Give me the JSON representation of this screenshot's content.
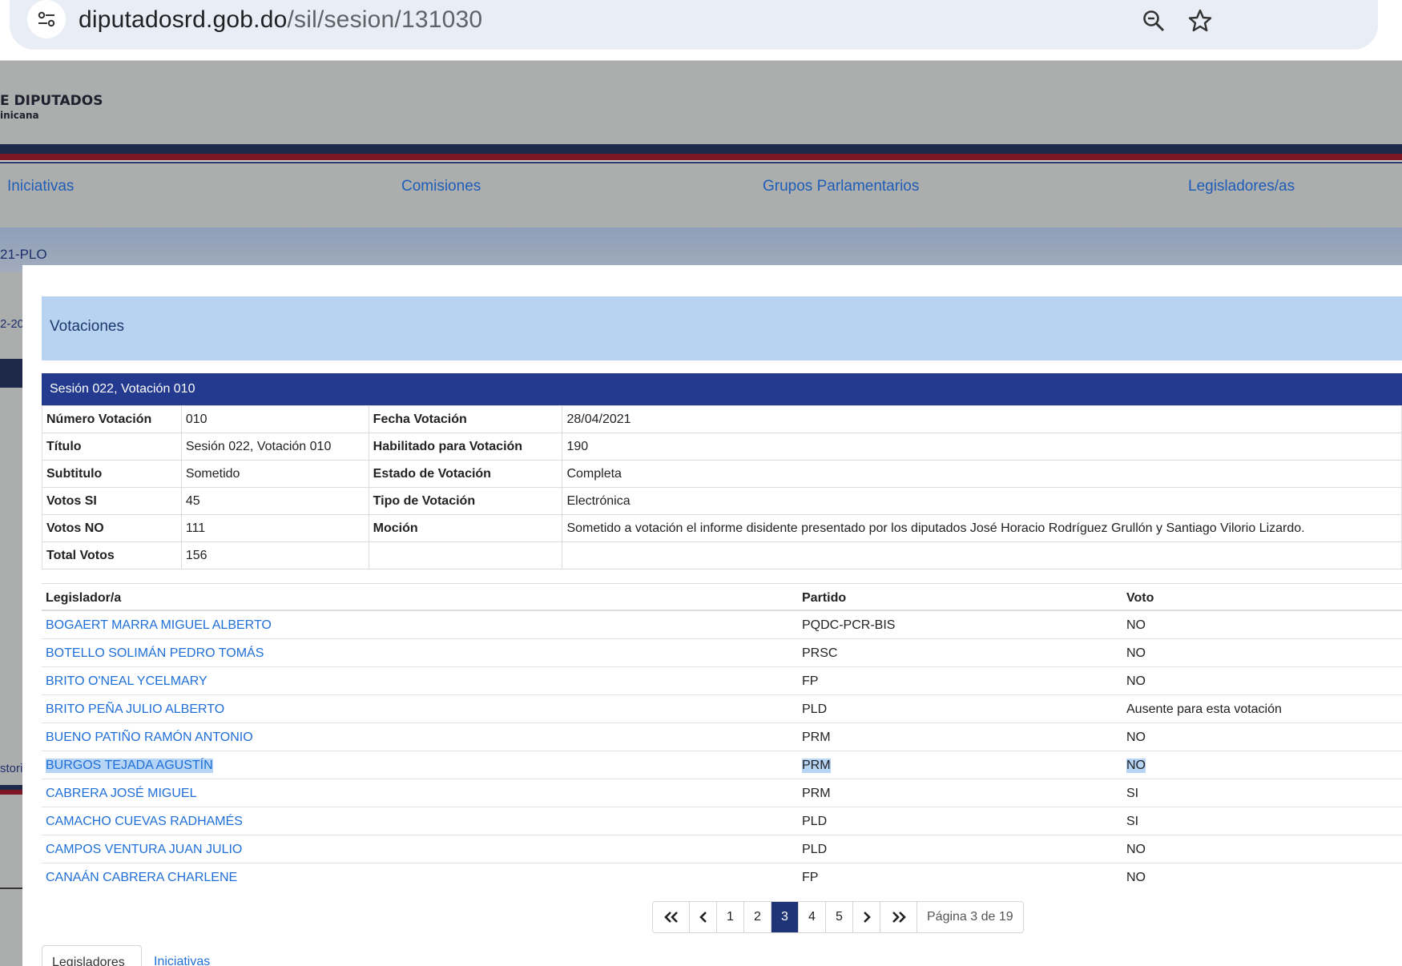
{
  "browser": {
    "url_domain": "diputadosrd.gob.do",
    "url_path": "/sil/sesion/131030",
    "site_info_icon": "tune-icon",
    "zoom_icon": "zoom-icon",
    "bookmark_icon": "star-icon"
  },
  "site": {
    "logo_line1": "E DIPUTADOS",
    "logo_line2": "inicana",
    "nav": [
      "Iniciativas",
      "Comisiones",
      "Grupos Parlamentarios",
      "Legisladores/as"
    ],
    "bg_fragments": [
      "21-PLO",
      "2-20",
      "stori"
    ]
  },
  "modal": {
    "section_title": "Votaciones",
    "session_title": "Sesión 022, Votación 010",
    "info": {
      "numero_votacion_label": "Número Votación",
      "numero_votacion": "010",
      "fecha_votacion_label": "Fecha Votación",
      "fecha_votacion": "28/04/2021",
      "titulo_label": "Título",
      "titulo": "Sesión 022, Votación 010",
      "habilitado_label": "Habilitado para Votación",
      "habilitado": "190",
      "subtitulo_label": "Subtitulo",
      "subtitulo": "Sometido",
      "estado_label": "Estado de Votación",
      "estado": "Completa",
      "votos_si_label": "Votos SI",
      "votos_si": "45",
      "tipo_label": "Tipo de Votación",
      "tipo": "Electrónica",
      "votos_no_label": "Votos NO",
      "votos_no": "111",
      "mocion_label": "Moción",
      "mocion": "Sometido a votación el informe disidente presentado por los diputados José Horacio Rodríguez Grullón y Santiago Vilorio Lizardo.",
      "total_label": "Total Votos",
      "total": "156"
    },
    "table": {
      "headers": {
        "legislator": "Legislador/a",
        "party": "Partido",
        "vote": "Voto"
      },
      "rows": [
        {
          "name": "BOGAERT MARRA MIGUEL ALBERTO",
          "party": "PQDC-PCR-BIS",
          "vote": "NO"
        },
        {
          "name": "BOTELLO SOLIMÁN PEDRO TOMÁS",
          "party": "PRSC",
          "vote": "NO"
        },
        {
          "name": "BRITO O'NEAL YCELMARY",
          "party": "FP",
          "vote": "NO"
        },
        {
          "name": "BRITO PEÑA JULIO ALBERTO",
          "party": "PLD",
          "vote": "Ausente para esta votación"
        },
        {
          "name": "BUENO PATIÑO RAMÓN ANTONIO",
          "party": "PRM",
          "vote": "NO"
        },
        {
          "name": "BURGOS TEJADA AGUSTÍN",
          "party": "PRM",
          "vote": "NO"
        },
        {
          "name": "CABRERA JOSÉ MIGUEL",
          "party": "PRM",
          "vote": "SI"
        },
        {
          "name": "CAMACHO CUEVAS RADHAMÉS",
          "party": "PLD",
          "vote": "SI"
        },
        {
          "name": "CAMPOS VENTURA JUAN JULIO",
          "party": "PLD",
          "vote": "NO"
        },
        {
          "name": "CANAÁN CABRERA CHARLENE",
          "party": "FP",
          "vote": "NO"
        }
      ]
    },
    "pagination": {
      "first_icon": "double-chevron-left-icon",
      "prev_icon": "chevron-left-icon",
      "pages": [
        "1",
        "2",
        "3",
        "4",
        "5"
      ],
      "current": "3",
      "next_icon": "chevron-right-icon",
      "last_icon": "double-chevron-right-icon",
      "info": "Página 3 de 19"
    },
    "tabs": [
      "Legisladores",
      "Iniciativas"
    ]
  },
  "colors": {
    "session_bar": "#233a8e",
    "section_header": "#b8d3f1",
    "link": "#1f6fd8",
    "highlight": "#b6d4f5",
    "active_page": "#1e3476"
  }
}
